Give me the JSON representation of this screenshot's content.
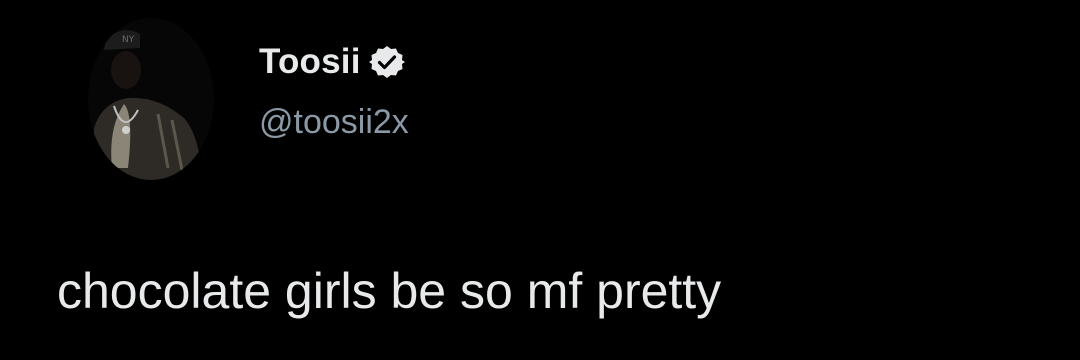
{
  "tweet": {
    "author": {
      "display_name": "Toosii",
      "handle": "@toosii2x",
      "verified": true,
      "verified_icon": "verified-badge-icon",
      "avatar_icon": "profile-photo"
    },
    "text": "chocolate girls be so mf pretty"
  },
  "colors": {
    "background": "#000000",
    "primary_text": "#e7e9ea",
    "secondary_text": "#8b98a5",
    "badge_fill": "#e7e9ea",
    "badge_check": "#000000"
  }
}
